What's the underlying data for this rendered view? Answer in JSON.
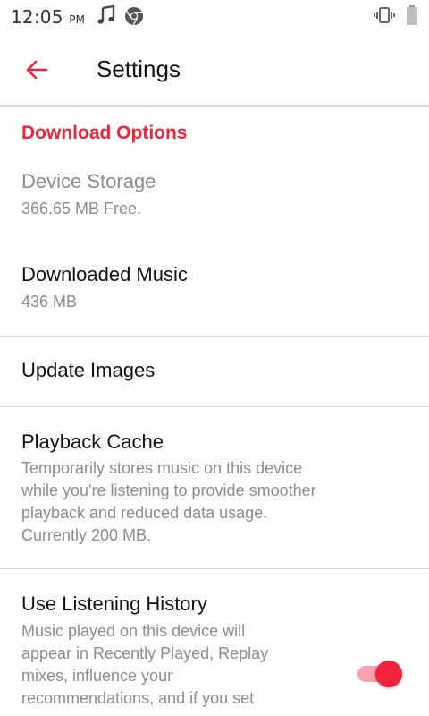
{
  "status_bar": {
    "time": "12:05",
    "ampm": "PM",
    "icons": [
      "music-note-icon",
      "chrome-icon",
      "vibrate-icon",
      "battery-icon"
    ]
  },
  "app_bar": {
    "title": "Settings",
    "back_icon": "back-arrow-icon"
  },
  "sections": {
    "download_options": {
      "header": "Download Options",
      "device_storage": {
        "title": "Device Storage",
        "subtitle": "366.65 MB Free."
      },
      "downloaded_music": {
        "title": "Downloaded Music",
        "subtitle": "436 MB"
      }
    },
    "update_images": {
      "title": "Update Images"
    },
    "playback_cache": {
      "title": "Playback Cache",
      "lines": [
        "Temporarily stores music on this device",
        "while you're listening to provide smoother",
        "playback and reduced data usage.",
        "Currently 200 MB."
      ]
    },
    "listening_history": {
      "title": "Use Listening History",
      "lines": [
        "Music played on this device will",
        "appear in Recently Played, Replay",
        "mixes, influence your",
        "recommendations, and if you set"
      ],
      "toggle_on": true
    }
  },
  "colors": {
    "accent": "#f0243a",
    "accent_light": "#f7a2ac",
    "secondary_text": "#8c8c8c",
    "divider": "#d8d8d8"
  }
}
